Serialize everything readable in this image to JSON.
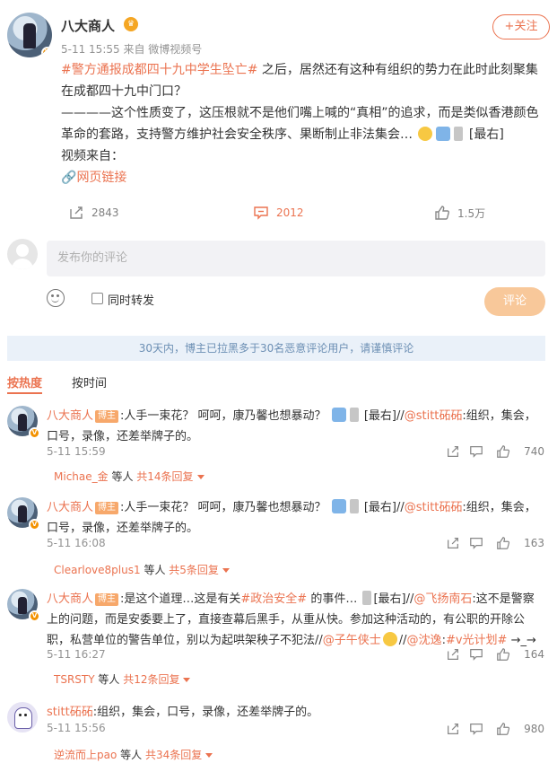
{
  "post": {
    "author": "八大商人",
    "meta": "5-11 15:55 来自 微博视频号",
    "follow_label": "+关注",
    "text_hashtag": "#警方通报成都四十九中学生坠亡#",
    "text_line1": "之后，居然还有这种有组织的势力在此时此刻聚集在成都四十九中门口？",
    "text_line2": "————这个性质变了，这压根就不是他们嘴上喊的“真相”的追求，而是类似香港颜色革命的套路，支持警方维护社会安全秩序、果断制止非法集会…",
    "text_tail": "[最右]",
    "text_line3": "视频来自：",
    "link_label": "网页链接",
    "reposts": "2843",
    "comments": "2012",
    "likes": "1.5万"
  },
  "composer": {
    "placeholder": "发布你的评论",
    "repost_label": "同时转发",
    "submit_label": "评论"
  },
  "notice": "30天内，博主已拉黑多于30名恶意评论用户，请谨慎评论",
  "sort_tabs": [
    "按热度",
    "按时间"
  ],
  "comments": [
    {
      "name": "八大商人",
      "badge": "博主",
      "p1": ":人手一束花？ 呵呵，康乃馨也想暴动？",
      "p2": "[最右]//",
      "mention": "@stitt砳砳",
      "p3": ":组织，集会，口号，录像，还差举牌子的。",
      "time": "5-11 15:59",
      "likes": "740",
      "reply_user": "Michae_金",
      "reply_mid": " 等人 ",
      "reply_count": "共14条回复"
    },
    {
      "name": "八大商人",
      "badge": "博主",
      "p1": ":人手一束花？ 呵呵，康乃馨也想暴动？",
      "p2": "[最右]//",
      "mention": "@stitt砳砳",
      "p3": ":组织，集会，口号，录像，还差举牌子的。",
      "time": "5-11 16:08",
      "likes": "163",
      "reply_user": "Clearlove8plus1",
      "reply_mid": " 等人 ",
      "reply_count": "共5条回复"
    },
    {
      "name": "八大商人",
      "badge": "博主",
      "p1": ":是这个道理…这是有关",
      "hashtag": "#政治安全#",
      "p2": " 的事件…",
      "p2b": "[最右]//",
      "mention": "@飞扬南石",
      "p3": ":这不是警察上的问题，而是安委要上了，直接查幕后黑手，从重从快。参加这种活动的，有公职的开除公职，私营单位的警告单位，别以为起哄架秧子不犯法//",
      "mention2": "@子午侠士",
      "p4": "//",
      "mention3": "@沈逸",
      "p5": ":",
      "hashtag2": "#v光计划#",
      "p6": " →_→",
      "time": "5-11 16:27",
      "likes": "164",
      "reply_user": "TSRSTY",
      "reply_mid": " 等人 ",
      "reply_count": "共12条回复"
    },
    {
      "name": "stitt砳砳",
      "p3": ":组织，集会，口号，录像，还差举牌子的。",
      "time": "5-11 15:56",
      "likes": "980",
      "reply_user": "逆流而上pao",
      "reply_mid": " 等人 ",
      "reply_count": "共34条回复"
    }
  ],
  "colors": {
    "accent": "#eb7350",
    "link": "#eb7350",
    "notice_bg": "#eaf1f9"
  }
}
